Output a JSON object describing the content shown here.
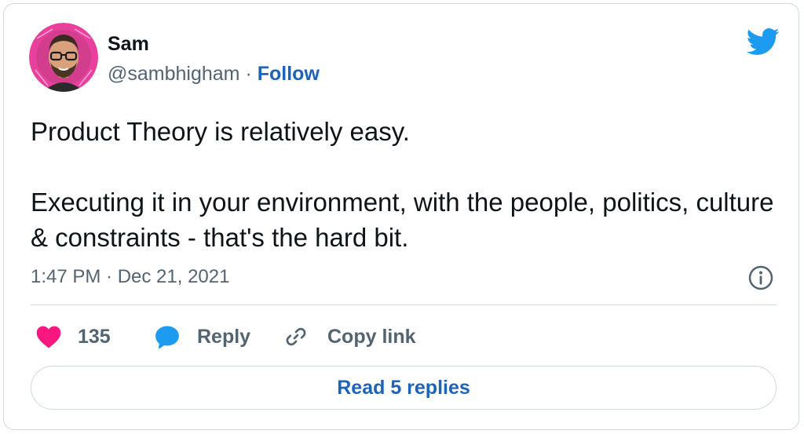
{
  "author": {
    "name": "Sam",
    "handle": "@sambhigham",
    "separator": "·",
    "follow_label": "Follow"
  },
  "tweet": {
    "paragraphs": [
      "Product Theory is relatively easy.",
      "Executing it in your environment, with the people, politics, culture & constraints - that's the hard bit."
    ],
    "timestamp": "1:47 PM · Dec 21, 2021"
  },
  "actions": {
    "like_count": "135",
    "reply_label": "Reply",
    "copy_link_label": "Copy link"
  },
  "read_replies_label": "Read 5 replies",
  "icons": {
    "brand": "twitter-bird-icon",
    "info": "info-icon",
    "like": "heart-icon",
    "reply": "speech-bubble-icon",
    "copy": "link-icon"
  },
  "colors": {
    "brand_blue": "#1d9bf0",
    "link_blue": "#1d63b8",
    "like_pink": "#f91880",
    "avatar_ring": "#e8409c"
  }
}
